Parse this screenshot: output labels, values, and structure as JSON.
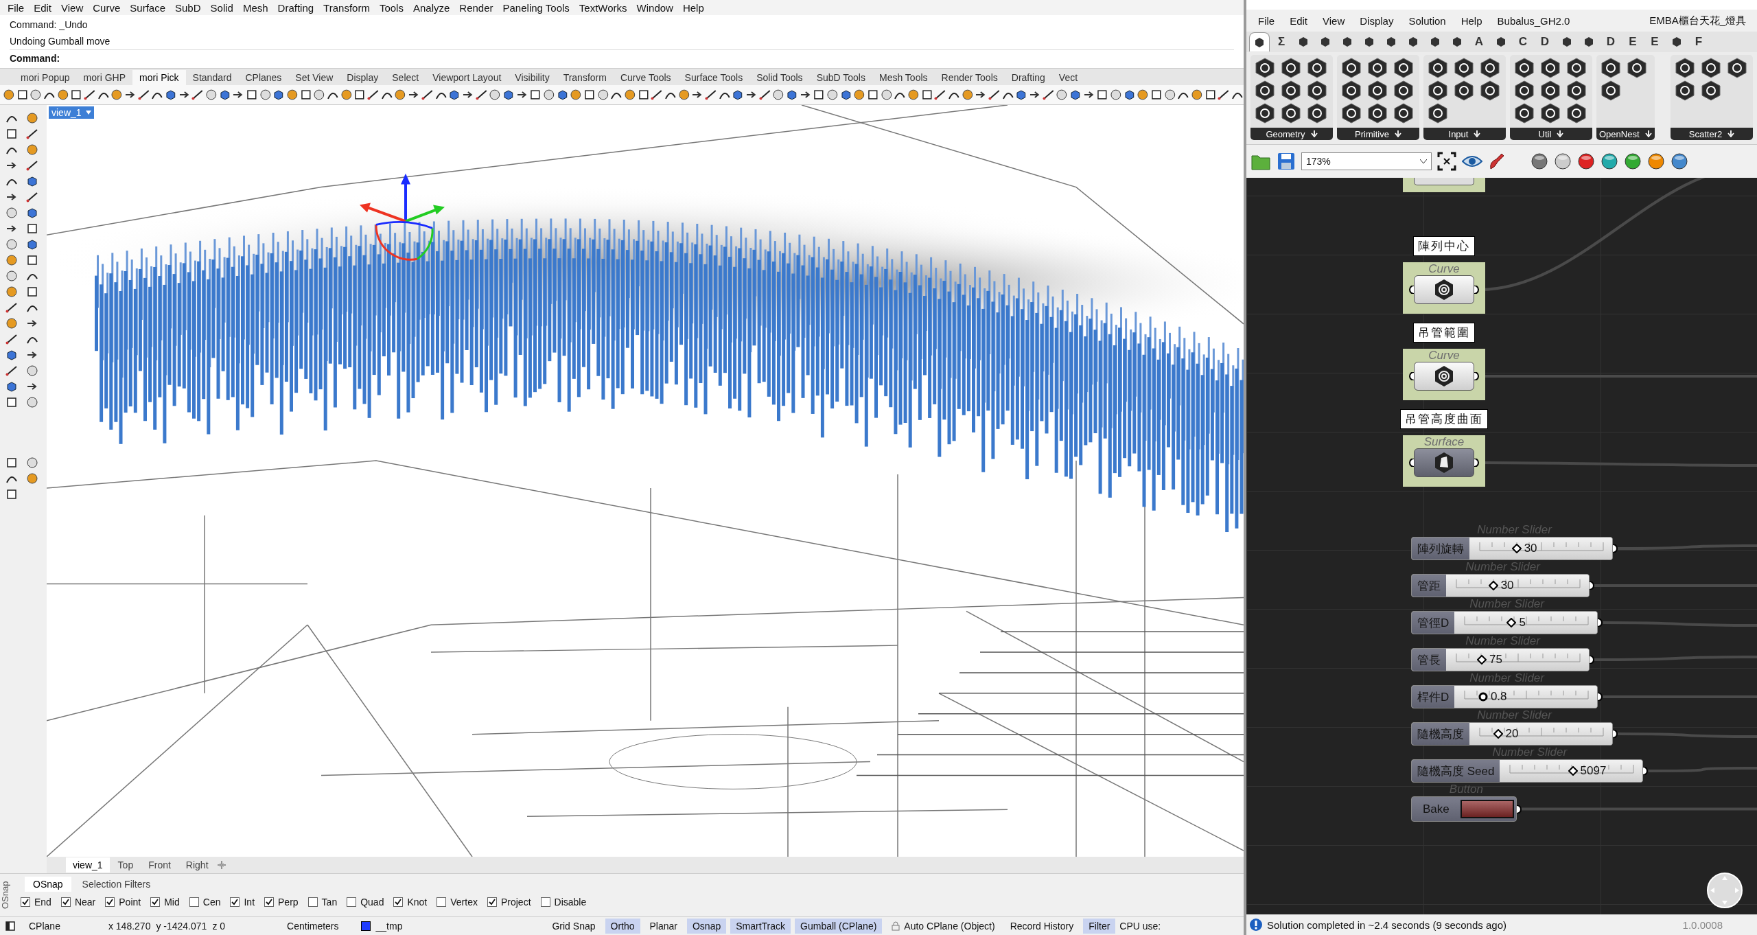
{
  "rhino": {
    "menu": [
      "File",
      "Edit",
      "View",
      "Curve",
      "Surface",
      "SubD",
      "Solid",
      "Mesh",
      "Drafting",
      "Transform",
      "Tools",
      "Analyze",
      "Render",
      "Paneling Tools",
      "TextWorks",
      "Window",
      "Help"
    ],
    "command_history": [
      "Command: _Undo",
      "Undoing Gumball move"
    ],
    "command_prompt": "Command:",
    "toolbar_tabs": [
      {
        "label": "mori Popup",
        "selected": false
      },
      {
        "label": "mori GHP",
        "selected": false
      },
      {
        "label": "mori Pick",
        "selected": true
      },
      {
        "label": "Standard",
        "selected": false
      },
      {
        "label": "CPlanes",
        "selected": false
      },
      {
        "label": "Set View",
        "selected": false
      },
      {
        "label": "Display",
        "selected": false
      },
      {
        "label": "Select",
        "selected": false
      },
      {
        "label": "Viewport Layout",
        "selected": false
      },
      {
        "label": "Visibility",
        "selected": false
      },
      {
        "label": "Transform",
        "selected": false
      },
      {
        "label": "Curve Tools",
        "selected": false
      },
      {
        "label": "Surface Tools",
        "selected": false
      },
      {
        "label": "Solid Tools",
        "selected": false
      },
      {
        "label": "SubD Tools",
        "selected": false
      },
      {
        "label": "Mesh Tools",
        "selected": false
      },
      {
        "label": "Render Tools",
        "selected": false
      },
      {
        "label": "Drafting",
        "selected": false
      },
      {
        "label": "Vect",
        "selected": false
      }
    ],
    "viewport": {
      "title": "view_1"
    },
    "viewport_tabs": [
      {
        "label": "view_1",
        "selected": true
      },
      {
        "label": "Top",
        "selected": false
      },
      {
        "label": "Front",
        "selected": false
      },
      {
        "label": "Right",
        "selected": false
      }
    ],
    "osnap": {
      "side_label": "OSnap",
      "tabs": [
        {
          "label": "OSnap",
          "selected": true
        },
        {
          "label": "Selection Filters",
          "selected": false
        }
      ],
      "snaps": [
        {
          "label": "End",
          "checked": true
        },
        {
          "label": "Near",
          "checked": true
        },
        {
          "label": "Point",
          "checked": true
        },
        {
          "label": "Mid",
          "checked": true
        },
        {
          "label": "Cen",
          "checked": false
        },
        {
          "label": "Int",
          "checked": true
        },
        {
          "label": "Perp",
          "checked": true
        },
        {
          "label": "Tan",
          "checked": false
        },
        {
          "label": "Quad",
          "checked": false
        },
        {
          "label": "Knot",
          "checked": true
        },
        {
          "label": "Vertex",
          "checked": false
        },
        {
          "label": "Project",
          "checked": true
        },
        {
          "label": "Disable",
          "checked": false
        }
      ]
    },
    "status_bar": {
      "cplane": "CPlane",
      "x": "x 148.270",
      "y": "y -1424.071",
      "z": "z 0",
      "units": "Centimeters",
      "layer": {
        "name": "__tmp",
        "color": "#1f3cff"
      },
      "toggles": [
        {
          "label": "Grid Snap",
          "on": false,
          "kind": "text"
        },
        {
          "label": "Ortho",
          "on": true,
          "kind": "text"
        },
        {
          "label": "Planar",
          "on": false,
          "kind": "text"
        },
        {
          "label": "Osnap",
          "on": true,
          "kind": "text"
        },
        {
          "label": "SmartTrack",
          "on": true,
          "kind": "text"
        },
        {
          "label": "Gumball (CPlane)",
          "on": true,
          "kind": "text"
        },
        {
          "label": "Auto CPlane (Object)",
          "on": false,
          "kind": "lock"
        },
        {
          "label": "Record History",
          "on": false,
          "kind": "text"
        },
        {
          "label": "Filter",
          "on": true,
          "kind": "text"
        }
      ],
      "cpu": "CPU use:"
    }
  },
  "grasshopper": {
    "menu": [
      "File",
      "Edit",
      "View",
      "Display",
      "Solution",
      "Help",
      "Bubalus_GH2.0"
    ],
    "document_title": "EMBA櫃台天花_燈具",
    "tabs": [
      {
        "kind": "icon",
        "selected": true
      },
      {
        "kind": "text",
        "label": "Σ",
        "selected": false
      },
      {
        "kind": "icon",
        "selected": false
      },
      {
        "kind": "icon",
        "selected": false
      },
      {
        "kind": "icon",
        "selected": false
      },
      {
        "kind": "icon",
        "selected": false
      },
      {
        "kind": "icon",
        "selected": false
      },
      {
        "kind": "icon",
        "selected": false
      },
      {
        "kind": "icon",
        "selected": false
      },
      {
        "kind": "icon",
        "selected": false
      },
      {
        "kind": "text",
        "label": "A",
        "selected": false
      },
      {
        "kind": "icon",
        "selected": false
      },
      {
        "kind": "text",
        "label": "C",
        "selected": false
      },
      {
        "kind": "text",
        "label": "D",
        "selected": false
      },
      {
        "kind": "icon",
        "selected": false
      },
      {
        "kind": "icon",
        "selected": false
      },
      {
        "kind": "text",
        "label": "D",
        "selected": false
      },
      {
        "kind": "text",
        "label": "E",
        "selected": false
      },
      {
        "kind": "text",
        "label": "E",
        "selected": false
      },
      {
        "kind": "icon",
        "selected": false
      },
      {
        "kind": "text",
        "label": "F",
        "selected": false
      }
    ],
    "panels": [
      {
        "label": "Geometry"
      },
      {
        "label": "Primitive"
      },
      {
        "label": "Input"
      },
      {
        "label": "Util"
      },
      {
        "label": "OpenNest"
      },
      {
        "label": "Scatter2"
      }
    ],
    "zoom": "173%",
    "params": [
      {
        "nickname": "陣列中心",
        "type": "Curve",
        "kind": "curve"
      },
      {
        "nickname": "吊管範圍",
        "type": "Curve",
        "kind": "curve"
      },
      {
        "nickname": "吊管高度曲面",
        "type": "Surface",
        "kind": "surface"
      }
    ],
    "sliders": [
      {
        "type": "Number Slider",
        "label": "陣列旋轉",
        "value": "30",
        "level": 0.33,
        "kind": "integer"
      },
      {
        "type": "Number Slider",
        "label": "管距",
        "value": "30",
        "level": 0.33,
        "kind": "integer"
      },
      {
        "type": "Number Slider",
        "label": "管徑D",
        "value": "5",
        "level": 0.4,
        "kind": "integer"
      },
      {
        "type": "Number Slider",
        "label": "管長",
        "value": "75",
        "level": 0.25,
        "kind": "integer"
      },
      {
        "type": "Number Slider",
        "label": "桿件D",
        "value": "0.8",
        "level": 0.2,
        "kind": "decimal"
      },
      {
        "type": "Number Slider",
        "label": "隨機高度",
        "value": "20",
        "level": 0.2,
        "kind": "integer"
      },
      {
        "type": "Number Slider",
        "label": "隨機高度 Seed",
        "value": "5097",
        "level": 0.51,
        "kind": "integer"
      }
    ],
    "button": {
      "type": "Button",
      "label": "Bake"
    },
    "status": "Solution completed in ~2.4 seconds (9 seconds ago)",
    "version": "1.0.0008"
  }
}
